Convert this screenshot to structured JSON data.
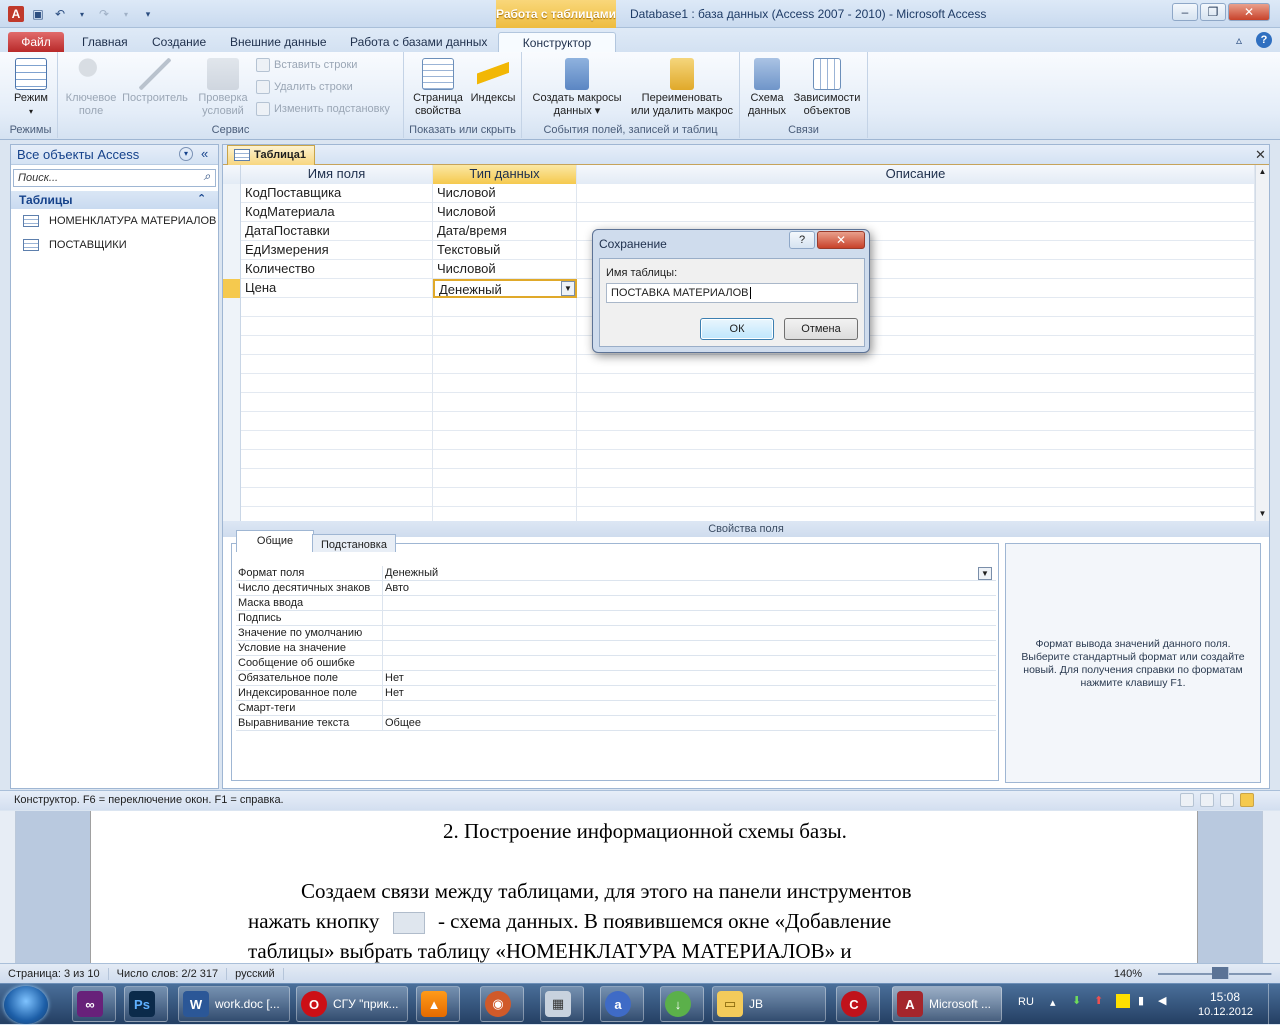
{
  "title_bar": {
    "context_band": "Работа с таблицами",
    "window_title": "Database1 : база данных (Access 2007 - 2010)  -  Microsoft Access"
  },
  "ribbon_tabs": [
    "Файл",
    "Главная",
    "Создание",
    "Внешние данные",
    "Работа с базами данных",
    "Конструктор"
  ],
  "ribbon": {
    "mode": "Режим",
    "key_field": "Ключевое\nполе",
    "builder": "Построитель",
    "check_rules": "Проверка\nусловий",
    "insert_rows": "Вставить строки",
    "delete_rows": "Удалить строки",
    "change_lookup": "Изменить подстановку",
    "property_sheet": "Страница\nсвойства",
    "indexes": "Индексы",
    "create_macros": "Создать макросы\nданных ▾",
    "rename_macro": "Переименовать\nили удалить макрос",
    "relationships": "Схема\nданных",
    "dependencies": "Зависимости\nобъектов",
    "groups": {
      "modes": "Режимы",
      "service": "Сервис",
      "show_hide": "Показать или скрыть",
      "events": "События полей, записей и таблиц",
      "links": "Связи"
    }
  },
  "nav": {
    "header": "Все объекты Access",
    "search_placeholder": "Поиск...",
    "group": "Таблицы",
    "items": [
      "НОМЕНКЛАТУРА МАТЕРИАЛОВ",
      "ПОСТАВЩИКИ"
    ]
  },
  "document": {
    "tab": "Таблица1",
    "columns": [
      "Имя поля",
      "Тип данных",
      "Описание"
    ],
    "rows": [
      {
        "name": "КодПоставщика",
        "type": "Числовой"
      },
      {
        "name": "КодМатериала",
        "type": "Числовой"
      },
      {
        "name": "ДатаПоставки",
        "type": "Дата/время"
      },
      {
        "name": "ЕдИзмерения",
        "type": "Текстовый"
      },
      {
        "name": "Количество",
        "type": "Числовой"
      },
      {
        "name": "Цена",
        "type": "Денежный"
      }
    ],
    "field_props_label": "Свойства поля",
    "prop_tabs": [
      "Общие",
      "Подстановка"
    ],
    "props": [
      {
        "k": "Формат поля",
        "v": "Денежный"
      },
      {
        "k": "Число десятичных знаков",
        "v": "Авто"
      },
      {
        "k": "Маска ввода",
        "v": ""
      },
      {
        "k": "Подпись",
        "v": ""
      },
      {
        "k": "Значение по умолчанию",
        "v": ""
      },
      {
        "k": "Условие на значение",
        "v": ""
      },
      {
        "k": "Сообщение об ошибке",
        "v": ""
      },
      {
        "k": "Обязательное поле",
        "v": "Нет"
      },
      {
        "k": "Индексированное поле",
        "v": "Нет"
      },
      {
        "k": "Смарт-теги",
        "v": ""
      },
      {
        "k": "Выравнивание текста",
        "v": "Общее"
      }
    ],
    "help_text": "Формат вывода значений данного поля. Выберите стандартный формат или создайте новый. Для получения справки по форматам нажмите клавишу F1."
  },
  "dialog": {
    "title": "Сохранение",
    "label": "Имя таблицы:",
    "value": "ПОСТАВКА МАТЕРИАЛОВ",
    "ok": "ОК",
    "cancel": "Отмена"
  },
  "status": "Конструктор.  F6 = переключение окон.  F1 = справка.",
  "word": {
    "heading": "2. Построение информационной схемы базы.",
    "para1a": "Создаем связи между таблицами, для этого на панели инструментов",
    "para1b_pre": "нажать кнопку",
    "para1b_post": " - схема данных. В появившемся окне «Добавление",
    "para1c": "таблицы» выбрать таблицу «НОМЕНКЛАТУРА МАТЕРИАЛОВ» и",
    "status": [
      "Страница: 3 из 10",
      "Число слов: 2/2 317",
      "русский"
    ],
    "zoom": "140%"
  },
  "taskbar": {
    "items": [
      "work.doc [...",
      "СГУ \"прик...",
      "JB",
      "Microsoft ..."
    ],
    "lang": "RU",
    "time": "15:08",
    "date": "10.12.2012"
  }
}
